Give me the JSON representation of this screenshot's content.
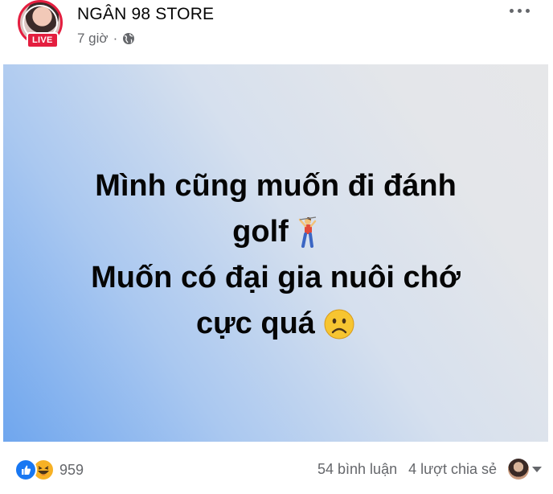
{
  "header": {
    "page_name": "NGÂN 98 STORE",
    "live_label": "LIVE",
    "time_ago": "7 giờ",
    "separator": "·",
    "privacy_icon": "globe-icon",
    "more_icon": "more-options-icon"
  },
  "post": {
    "line1": "Mình cũng muốn đi đánh",
    "line2": "golf",
    "line2_emoji": "golfer-icon",
    "line3": "Muốn có đại gia nuôi chớ",
    "line4": "cực quá",
    "line4_emoji": "frowning-face-icon",
    "bg_start": "#6fa6ee",
    "bg_end": "#e6e7e9"
  },
  "footer": {
    "reaction_icons": [
      "like-icon",
      "haha-icon"
    ],
    "reaction_count": "959",
    "comments": "54 bình luận",
    "shares": "4 lượt chia sẻ",
    "viewer_icon": "viewer-avatar",
    "dropdown_icon": "caret-down-icon"
  },
  "colors": {
    "live_red": "#e41e3f",
    "like_blue": "#1877f2",
    "secondary_text": "#65676b"
  }
}
